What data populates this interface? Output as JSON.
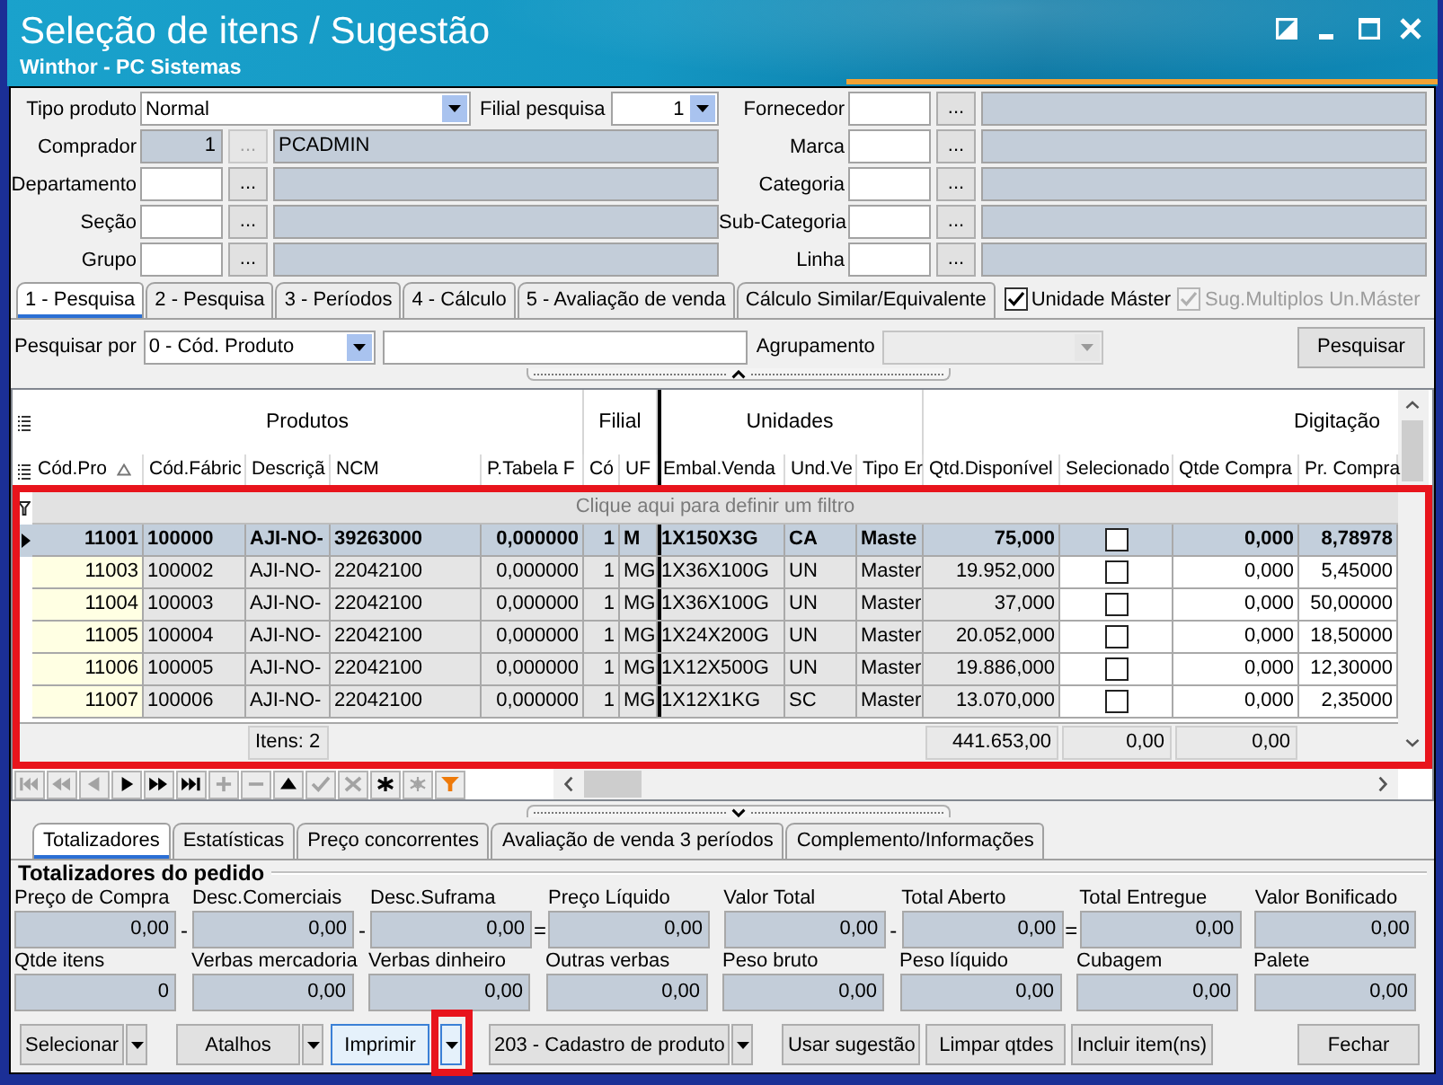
{
  "window": {
    "title": "Seleção de itens / Sugestão",
    "subtitle": "Winthor - PC Sistemas"
  },
  "filters": {
    "product_type": {
      "label": "Tipo produto",
      "value": "Normal"
    },
    "branch": {
      "label": "Filial pesquisa",
      "value": "1"
    },
    "left_lookups": [
      {
        "label": "Comprador",
        "code": "1",
        "button": "...",
        "name": "PCADMIN",
        "disabled": true
      },
      {
        "label": "Departamento",
        "button": "...",
        "disabled": false
      },
      {
        "label": "Seção",
        "button": "...",
        "disabled": false
      },
      {
        "label": "Grupo",
        "button": "...",
        "disabled": false
      }
    ],
    "right_lookups": [
      {
        "label": "Fornecedor",
        "button": "...",
        "disabled": false
      },
      {
        "label": "Marca",
        "button": "...",
        "disabled": false
      },
      {
        "label": "Categoria",
        "button": "...",
        "disabled": false
      },
      {
        "label": "Sub-Categoria",
        "button": "...",
        "disabled": false
      },
      {
        "label": "Linha",
        "button": "...",
        "disabled": false
      }
    ]
  },
  "search_tabs": [
    {
      "label": "1 - Pesquisa",
      "selected": true
    },
    {
      "label": "2 - Pesquisa",
      "selected": false
    },
    {
      "label": "3 - Períodos",
      "selected": false
    },
    {
      "label": "4 - Cálculo",
      "selected": false
    },
    {
      "label": "5 - Avaliação de venda",
      "selected": false
    },
    {
      "label": "Cálculo Similar/Equivalente",
      "selected": false
    }
  ],
  "options": [
    {
      "label": "Unidade Máster",
      "checked": true,
      "disabled": false
    },
    {
      "label": "Sug.Multiplos Un.Máster",
      "checked": true,
      "disabled": true
    }
  ],
  "search": {
    "label": "Pesquisar por",
    "field": "0 - Cód. Produto",
    "grouping_label": "Agrupamento",
    "grouping_disabled": true,
    "button": "Pesquisar"
  },
  "grid": {
    "highlighted": true,
    "groups": [
      {
        "label": "Produtos",
        "columns": [
          {
            "label": "Cód.Pro",
            "kind": "number",
            "sorted": true,
            "editable": false
          },
          {
            "label": "Cód.Fábric",
            "kind": "text",
            "sorted": false,
            "editable": false
          },
          {
            "label": "Descriçã",
            "kind": "text",
            "sorted": false,
            "editable": false,
            "footer": "Itens: 2"
          },
          {
            "label": "NCM",
            "kind": "text",
            "sorted": false,
            "editable": false
          },
          {
            "label": "P.Tabela F",
            "kind": "number",
            "sorted": false,
            "editable": false
          }
        ]
      },
      {
        "label": "Filial",
        "columns": [
          {
            "label": "Có",
            "kind": "number",
            "sorted": false,
            "editable": false
          },
          {
            "label": "UF",
            "kind": "text",
            "sorted": false,
            "editable": false
          }
        ]
      },
      {
        "label": "Unidades",
        "columns": [
          {
            "label": "Embal.Venda",
            "kind": "text",
            "sorted": false,
            "editable": false
          },
          {
            "label": "Und.Ve",
            "kind": "text",
            "sorted": false,
            "editable": false
          },
          {
            "label": "Tipo Er",
            "kind": "text",
            "sorted": false,
            "editable": false
          }
        ]
      },
      {
        "label": "Digitação",
        "columns": [
          {
            "label": "Qtd.Disponível",
            "kind": "number",
            "sorted": false,
            "editable": false,
            "footer": "441.653,00"
          },
          {
            "label": "Selecionado",
            "kind": "check",
            "sorted": false,
            "editable": true,
            "footer": "0,00"
          },
          {
            "label": "Qtde Compra",
            "kind": "number",
            "sorted": false,
            "editable": true,
            "footer": "0,00"
          },
          {
            "label": "Pr. Compra",
            "kind": "number",
            "sorted": false,
            "editable": true
          }
        ]
      }
    ],
    "filter_row": "Clique aqui para definir um filtro",
    "rows": [
      {
        "selected": true,
        "checked": false,
        "cells": [
          "11001",
          "100000",
          "AJI-NO-",
          "39263000",
          "0,000000",
          "1",
          "M",
          "1X150X3G",
          "CA",
          "Maste",
          "75,000",
          "0,000",
          "8,78978"
        ]
      },
      {
        "selected": false,
        "checked": false,
        "cells": [
          "11003",
          "100002",
          "AJI-NO-",
          "22042100",
          "0,000000",
          "1",
          "MG",
          "1X36X100G",
          "UN",
          "Master",
          "19.952,000",
          "0,000",
          "5,45000"
        ]
      },
      {
        "selected": false,
        "checked": false,
        "cells": [
          "11004",
          "100003",
          "AJI-NO-",
          "22042100",
          "0,000000",
          "1",
          "MG",
          "1X36X100G",
          "UN",
          "Master",
          "37,000",
          "0,000",
          "50,00000"
        ]
      },
      {
        "selected": false,
        "checked": false,
        "cells": [
          "11005",
          "100004",
          "AJI-NO-",
          "22042100",
          "0,000000",
          "1",
          "MG",
          "1X24X200G",
          "UN",
          "Master",
          "20.052,000",
          "0,000",
          "18,50000"
        ]
      },
      {
        "selected": false,
        "checked": false,
        "cells": [
          "11006",
          "100005",
          "AJI-NO-",
          "22042100",
          "0,000000",
          "1",
          "MG",
          "1X12X500G",
          "UN",
          "Master",
          "19.886,000",
          "0,000",
          "12,30000"
        ]
      },
      {
        "selected": false,
        "checked": false,
        "cells": [
          "11007",
          "100006",
          "AJI-NO-",
          "22042100",
          "0,000000",
          "1",
          "MG",
          "1X12X1KG",
          "SC",
          "Master",
          "13.070,000",
          "0,000",
          "2,35000"
        ]
      }
    ],
    "navigator": [
      {
        "kind": "first",
        "disabled": true
      },
      {
        "kind": "prior_page",
        "disabled": true
      },
      {
        "kind": "prior",
        "disabled": true
      },
      {
        "kind": "next",
        "disabled": false
      },
      {
        "kind": "next_page",
        "disabled": false
      },
      {
        "kind": "last",
        "disabled": false
      },
      {
        "kind": "insert",
        "disabled": true
      },
      {
        "kind": "delete",
        "disabled": true
      },
      {
        "kind": "edit",
        "disabled": false
      },
      {
        "kind": "post",
        "disabled": true
      },
      {
        "kind": "cancel",
        "disabled": true
      },
      {
        "kind": "refresh",
        "disabled": false
      },
      {
        "kind": "apply",
        "disabled": true
      },
      {
        "kind": "filter",
        "disabled": false
      }
    ]
  },
  "detail_tabs": [
    {
      "label": "Totalizadores",
      "selected": true
    },
    {
      "label": "Estatísticas",
      "selected": false
    },
    {
      "label": "Preço concorrentes",
      "selected": false
    },
    {
      "label": "Avaliação de venda 3 períodos",
      "selected": false
    },
    {
      "label": "Complemento/Informações",
      "selected": false
    }
  ],
  "totals": {
    "title": "Totalizadores do pedido",
    "rows": [
      {
        "fields": [
          {
            "label": "Preço de Compra",
            "value": "0,00",
            "operator": "-"
          },
          {
            "label": "Desc.Comerciais",
            "value": "0,00",
            "operator": "-"
          },
          {
            "label": "Desc.Suframa",
            "value": "0,00",
            "operator": "="
          },
          {
            "label": "Preço Líquido",
            "value": "0,00"
          },
          {
            "label": "Valor Total",
            "value": "0,00",
            "operator": "-"
          },
          {
            "label": "Total Aberto",
            "value": "0,00",
            "operator": "="
          },
          {
            "label": "Total Entregue",
            "value": "0,00"
          },
          {
            "label": "Valor Bonificado",
            "value": "0,00"
          }
        ]
      },
      {
        "fields": [
          {
            "label": "Qtde itens",
            "value": "0"
          },
          {
            "label": "Verbas mercadoria",
            "value": "0,00"
          },
          {
            "label": "Verbas dinheiro",
            "value": "0,00"
          },
          {
            "label": "Outras verbas",
            "value": "0,00"
          },
          {
            "label": "Peso bruto",
            "value": "0,00"
          },
          {
            "label": "Peso líquido",
            "value": "0,00"
          },
          {
            "label": "Cubagem",
            "value": "0,00"
          },
          {
            "label": "Palete",
            "value": "0,00"
          }
        ]
      }
    ]
  },
  "actions": [
    {
      "label": "Selecionar",
      "focused": false,
      "dropdown": {
        "highlighted": false
      }
    },
    {
      "label": "Atalhos",
      "focused": false,
      "dropdown": {
        "highlighted": false
      }
    },
    {
      "label": "Imprimir",
      "focused": true,
      "dropdown": {
        "highlighted": true
      }
    },
    {
      "label": "203 - Cadastro de produto",
      "focused": false,
      "dropdown": {
        "highlighted": false
      }
    },
    {
      "label": "Usar sugestão",
      "focused": false
    },
    {
      "label": "Limpar qtdes",
      "focused": false
    },
    {
      "label": "Incluir item(ns)",
      "focused": false
    }
  ],
  "close_button": "Fechar"
}
